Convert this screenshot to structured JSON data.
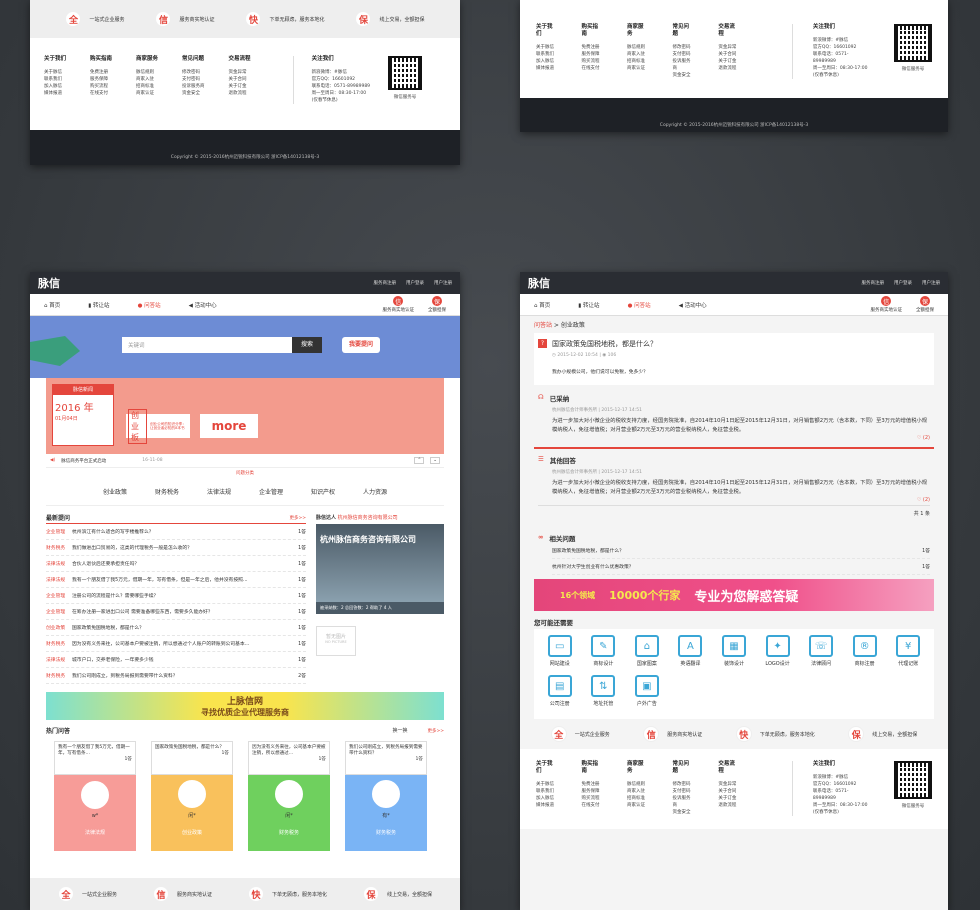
{
  "services": [
    {
      "icon": "全",
      "label": "一站式企业服务"
    },
    {
      "icon": "信",
      "label": "服务商实地认证"
    },
    {
      "icon": "快",
      "label": "下单无顾虑，服务本地化"
    },
    {
      "icon": "保",
      "label": "线上交易，全额担保"
    }
  ],
  "footer": {
    "cols": [
      {
        "title": "关于我们",
        "items": [
          "关于脉信",
          "联系我们",
          "加入脉信",
          "媒体报道"
        ]
      },
      {
        "title": "购买指南",
        "items": [
          "免费注册",
          "服务保障",
          "购买流程",
          "在线支付"
        ]
      },
      {
        "title": "商家服务",
        "items": [
          "脉信规则",
          "商家入驻",
          "招商标准",
          "商家认证"
        ]
      },
      {
        "title": "常见问题",
        "items": [
          "修改密码",
          "支付密码",
          "投诉服务商",
          "资金安全"
        ]
      },
      {
        "title": "交易流程",
        "items": [
          "资金异常",
          "关于合同",
          "关于订金",
          "退款流程"
        ]
      }
    ],
    "follow_title": "关注我们",
    "follow_lines": [
      "新浪微博：#脉信",
      "官方QQ：16601092",
      "联系电话：0571-89989989",
      "周一至周日：08:30-17:00",
      "(仅春节休息)"
    ],
    "qr_label": "微信服务号",
    "copyright": "Copyright © 2015-2016杭州迈锐科技有限公司 浙ICP备14012138号-3"
  },
  "header": {
    "logo": "脉信",
    "links": [
      "服务商注册",
      "用户登录",
      "用户注册"
    ]
  },
  "nav": {
    "items": [
      "首页",
      "转让站",
      "问答站",
      "活动中心"
    ],
    "right": [
      "服务商实地认证",
      "全额担保"
    ],
    "right_icons": [
      "信",
      "保"
    ]
  },
  "search": {
    "placeholder": "关键词",
    "button": "搜索",
    "ask": "我要提问"
  },
  "news": {
    "label": "脉信新闻",
    "year": "2016 年",
    "date": "01月04日",
    "small": "创业板",
    "more": "more",
    "side": "创业公司的知识分享：让创业者必知的8本书",
    "ticker": "脉信商务平台正式启动",
    "ticker_date": "16-11-08",
    "divider": "问题分类"
  },
  "categories": [
    "创业政策",
    "财务税务",
    "法律法规",
    "企业管理",
    "知识产权",
    "人力资源"
  ],
  "latest": {
    "title": "最新提问",
    "more": "更多>>",
    "rows": [
      {
        "cat": "企业管理",
        "q": "杭州滨江有什么适合的写字楼推荐么？",
        "n": "1答"
      },
      {
        "cat": "财务税务",
        "q": "我们做进出口贸易的，这类的代理税务一般是怎么收的？",
        "n": "1答"
      },
      {
        "cat": "法律法规",
        "q": "合伙人退伙后还要承担责任吗？",
        "n": "1答"
      },
      {
        "cat": "法律法规",
        "q": "我有一个朋友借了我5万元，借期一年，写有借条，但是一年之后，他并没有按照...",
        "n": "1答"
      },
      {
        "cat": "企业管理",
        "q": "注册公司的流程是什么？需要哪些手续？",
        "n": "1答"
      },
      {
        "cat": "企业管理",
        "q": "在筹办注册一家进出口公司 需要准备哪些东西，需要多久能办好？",
        "n": "1答"
      },
      {
        "cat": "创业政策",
        "q": "国家政策免国税地税，都是什么？",
        "n": "1答"
      },
      {
        "cat": "财务税务",
        "q": "因为没有义务来往，公司基本户要被注销，所以想通过个人账户的转账到公司基本...",
        "n": "1答"
      },
      {
        "cat": "法律法规",
        "q": "城市户口，交养老保险，一年要多少钱",
        "n": "1答"
      },
      {
        "cat": "财务税务",
        "q": "我们公司刚成立，到税务局报到需要带什么资料？",
        "n": "2答"
      }
    ]
  },
  "firm": {
    "title": "脉信达人",
    "name": "杭州脉信商务咨询有限公司",
    "banner": "杭州脉信商务咨询有限公司",
    "stats": "被采纳数：2  总回答数：2  帮助了 4 人",
    "nopic": "暂无图片",
    "nopic_en": "NO PICTURE"
  },
  "banner1": {
    "l1": "上脉信网",
    "l2": "寻找优质企业代理服务商"
  },
  "hot": {
    "title": "热门问答",
    "swap": "换一换",
    "more": "更多>>",
    "cards": [
      {
        "q": "我有一个朋友借了我5万元，借期一年，写有借条...",
        "n": "1答",
        "user": "w*",
        "cat": "法律法规",
        "color": "#f79c98"
      },
      {
        "q": "国家政策免国税地税，都是什么？",
        "n": "1答",
        "user": "闲*",
        "cat": "创业政策",
        "color": "#f9c15c"
      },
      {
        "q": "因为没有义务来往，公司基本户要被注销，所以想通过...",
        "n": "1答",
        "user": "闲*",
        "cat": "财务税务",
        "color": "#6fd05e"
      },
      {
        "q": "我们公司刚成立，到税务局报到需要带什么资料？",
        "n": "1答",
        "user": "有*",
        "cat": "财务税务",
        "color": "#7ab4f5"
      }
    ]
  },
  "detail": {
    "crumb": "问答站",
    "crumb2": "创业政策",
    "question": "国家政策免国税地税，都是什么？",
    "time": "2015-12-02 10:54",
    "views": "106",
    "desc": "我办小规模公司，他们说可以免税，免多少？",
    "accepted": "已采纳",
    "author": "杭州脉信会计师事务所",
    "adate": "2015-12-17 14:51",
    "answer": "为进一步加大对小微企业的税收支持力度，经国务院批准，自2014年10月1日起至2015年12月31日，对月销售额2万元（含本数，下同）至3万元的增值税小规模纳税人，免征增值税；对月营业额2万元至3万元的营业税纳税人，免征营业税。",
    "likes": "(2)",
    "other": "其他回答",
    "total": "共 1 条",
    "related": "相关问题",
    "rel": [
      {
        "q": "国家政策免国税地税，都是什么？",
        "n": "1答"
      },
      {
        "q": "杭州针对大学生创业有什么优惠政策？",
        "n": "1答"
      }
    ],
    "banner": {
      "a": "16个领域",
      "b": "10000个行家",
      "c": "专业为您解惑答疑"
    },
    "need": "您可能还需要",
    "icons": [
      {
        "i": "▭",
        "l": "网站建设"
      },
      {
        "i": "✎",
        "l": "商标设计"
      },
      {
        "i": "⌂",
        "l": "国家图案"
      },
      {
        "i": "A",
        "l": "英语翻译"
      },
      {
        "i": "▦",
        "l": "装饰设计"
      },
      {
        "i": "✦",
        "l": "LOGO设计"
      },
      {
        "i": "☏",
        "l": "法律顾问"
      },
      {
        "i": "®",
        "l": "商标注册"
      },
      {
        "i": "¥",
        "l": "代理记账"
      },
      {
        "i": "▤",
        "l": "公司注册"
      },
      {
        "i": "⇅",
        "l": "地址托管"
      },
      {
        "i": "▣",
        "l": "户外广告"
      }
    ]
  }
}
